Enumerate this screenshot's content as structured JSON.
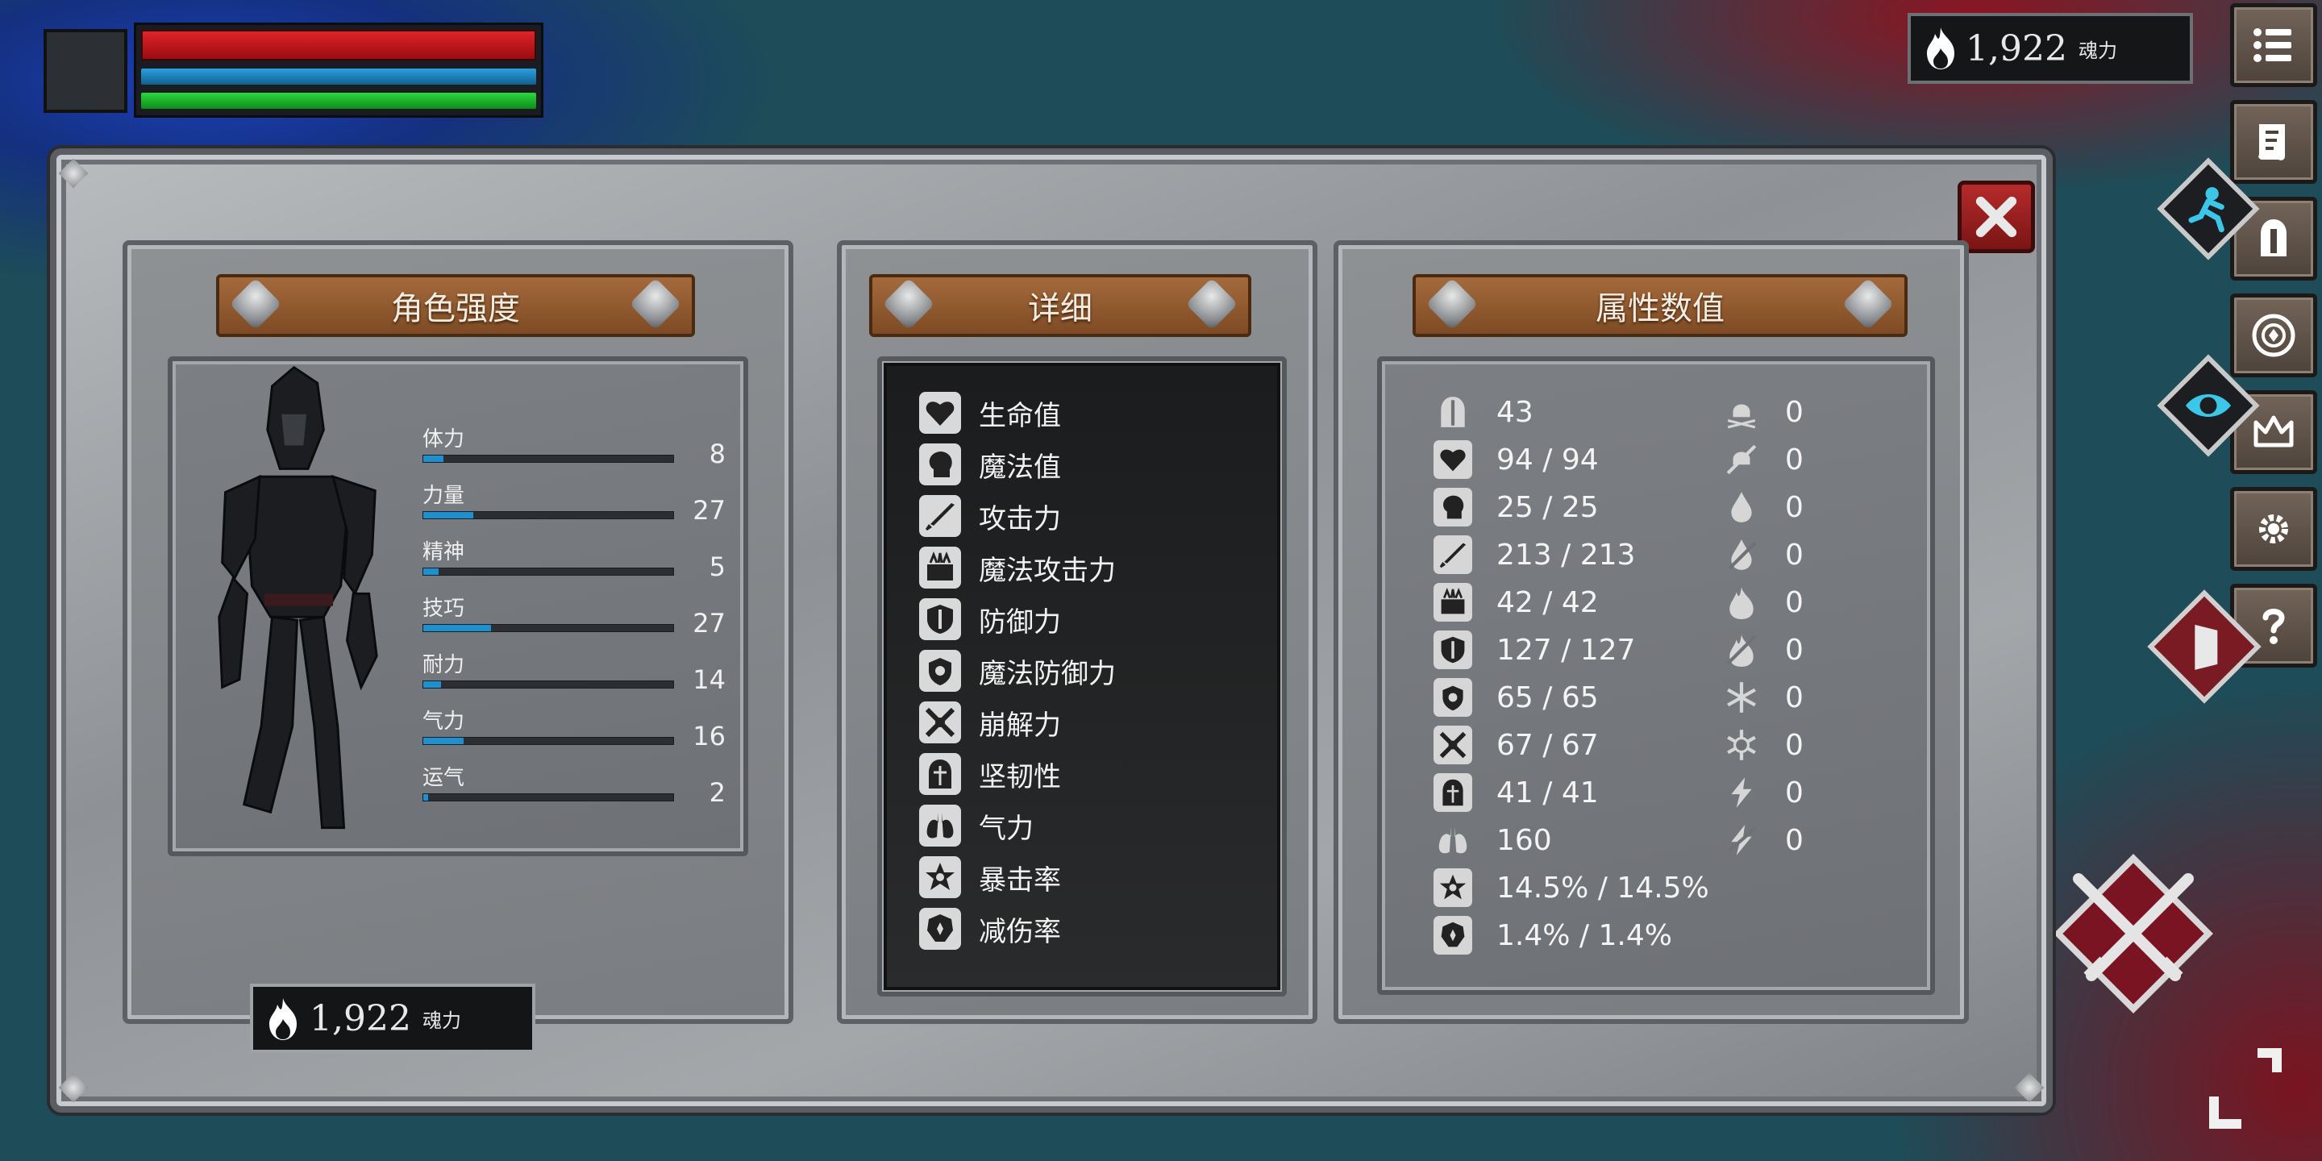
{
  "hud": {
    "hp_fill": 1.0,
    "mp_fill": 1.0,
    "stamina_fill": 1.0
  },
  "soul_top": {
    "value": "1,922",
    "unit": "魂力"
  },
  "panels": {
    "character": {
      "title": "角色强度",
      "stats": [
        {
          "label": "体力",
          "value": "8",
          "fill": 0.08
        },
        {
          "label": "力量",
          "value": "27",
          "fill": 0.2
        },
        {
          "label": "精神",
          "value": "5",
          "fill": 0.06
        },
        {
          "label": "技巧",
          "value": "27",
          "fill": 0.27
        },
        {
          "label": "耐力",
          "value": "14",
          "fill": 0.07
        },
        {
          "label": "气力",
          "value": "16",
          "fill": 0.16
        },
        {
          "label": "运气",
          "value": "2",
          "fill": 0.02
        }
      ],
      "soul": {
        "value": "1,922",
        "unit": "魂力"
      }
    },
    "detail": {
      "title": "详细",
      "items": [
        {
          "label": "生命值",
          "icon": "heart-icon"
        },
        {
          "label": "魔法值",
          "icon": "head-icon"
        },
        {
          "label": "攻击力",
          "icon": "sword-icon"
        },
        {
          "label": "魔法攻击力",
          "icon": "spellbook-icon"
        },
        {
          "label": "防御力",
          "icon": "shield-icon"
        },
        {
          "label": "魔法防御力",
          "icon": "magic-shield-icon"
        },
        {
          "label": "崩解力",
          "icon": "break-icon"
        },
        {
          "label": "坚韧性",
          "icon": "helmet-icon"
        },
        {
          "label": "气力",
          "icon": "lungs-icon"
        },
        {
          "label": "暴击率",
          "icon": "crit-star-icon"
        },
        {
          "label": "减伤率",
          "icon": "damage-reduce-icon"
        }
      ]
    },
    "attributes": {
      "title": "属性数值",
      "left": [
        {
          "icon": "helmet-icon",
          "value": "43"
        },
        {
          "icon": "heart-icon",
          "value": "94 / 94"
        },
        {
          "icon": "head-icon",
          "value": "25 / 25"
        },
        {
          "icon": "sword-icon",
          "value": "213 / 213"
        },
        {
          "icon": "spellbook-icon",
          "value": "42 / 42"
        },
        {
          "icon": "shield-icon",
          "value": "127 / 127"
        },
        {
          "icon": "magic-shield-icon",
          "value": "65 / 65"
        },
        {
          "icon": "break-icon",
          "value": "67 / 67"
        },
        {
          "icon": "helmet-icon",
          "value": "41 / 41"
        },
        {
          "icon": "lungs-icon",
          "value": "160"
        },
        {
          "icon": "crit-star-icon",
          "value": "14.5% / 14.5%"
        },
        {
          "icon": "damage-reduce-icon",
          "value": "1.4% / 1.4%"
        }
      ],
      "right": [
        {
          "icon": "poison-skull-icon",
          "value": "0"
        },
        {
          "icon": "poison-resist-icon",
          "value": "0"
        },
        {
          "icon": "blood-drop-icon",
          "value": "0"
        },
        {
          "icon": "bleed-resist-icon",
          "value": "0"
        },
        {
          "icon": "fire-icon",
          "value": "0"
        },
        {
          "icon": "fire-resist-icon",
          "value": "0"
        },
        {
          "icon": "frost-icon",
          "value": "0"
        },
        {
          "icon": "frost-resist-icon",
          "value": "0"
        },
        {
          "icon": "lightning-icon",
          "value": "0"
        },
        {
          "icon": "lightning-resist-icon",
          "value": "0"
        }
      ]
    }
  },
  "colors": {
    "stat_bar": "#1e8fcf",
    "hp": "#c0141a",
    "mp": "#1a7fb8",
    "stamina": "#1bb82c"
  }
}
